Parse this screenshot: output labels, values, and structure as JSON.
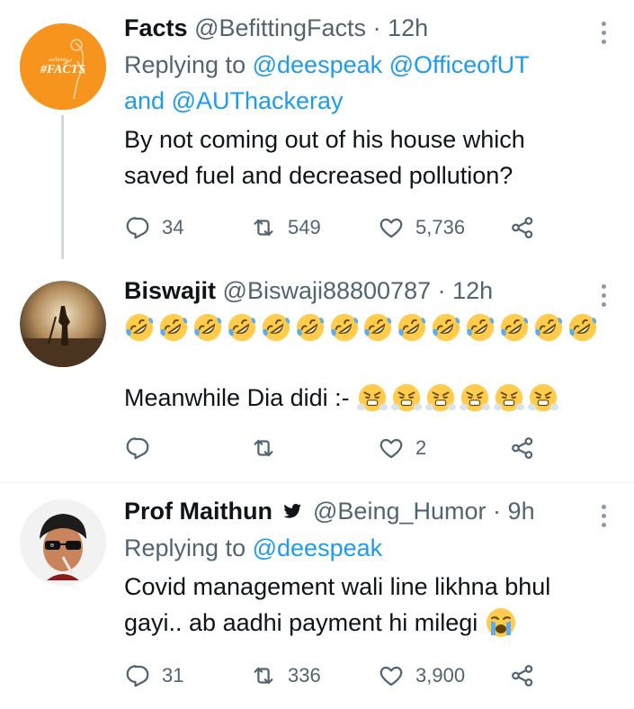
{
  "tweets": [
    {
      "name": "Facts",
      "handle": "@BefittingFacts",
      "dot": "·",
      "time": "12h",
      "avatar_text": "#FACTS",
      "avatar_small": "outlining",
      "reply_prefix": "Replying to",
      "reply_mentions": [
        "@deespeak",
        "@OfficeofUT"
      ],
      "reply_and": "and",
      "reply_mention_3": "@AUThackeray",
      "text_line1": "By not coming out of his house which",
      "text_line2": "saved fuel and decreased pollution?",
      "replies": "34",
      "retweets": "549",
      "likes": "5,736"
    },
    {
      "name": "Biswajit",
      "handle": "@Biswaji88800787",
      "dot": "·",
      "time": "12h",
      "emoji_line_count": 14,
      "emoji_line_name": "rolling-on-floor-laughing",
      "text_line": "Meanwhile Dia didi :-",
      "emoji_trailing_count": 6,
      "emoji_trailing_name": "face-with-steam",
      "replies": "",
      "retweets": "",
      "likes": "2"
    },
    {
      "name": "Prof Maithun",
      "verified_icon": "bird-icon",
      "handle": "@Being_Humor",
      "dot": "·",
      "time": "9h",
      "reply_prefix": "Replying to",
      "reply_mention": "@deespeak",
      "text_line1": "Covid management wali line likhna bhul",
      "text_line2": "gayi.. ab aadhi payment hi milegi",
      "trailing_emoji": "loudly-crying-face",
      "replies": "31",
      "retweets": "336",
      "likes": "3,900"
    }
  ],
  "colors": {
    "accent": "#1d9bf0",
    "secondary_text": "#536471",
    "primary_text": "#0f1419",
    "avatar_orange": "#f7941d"
  }
}
